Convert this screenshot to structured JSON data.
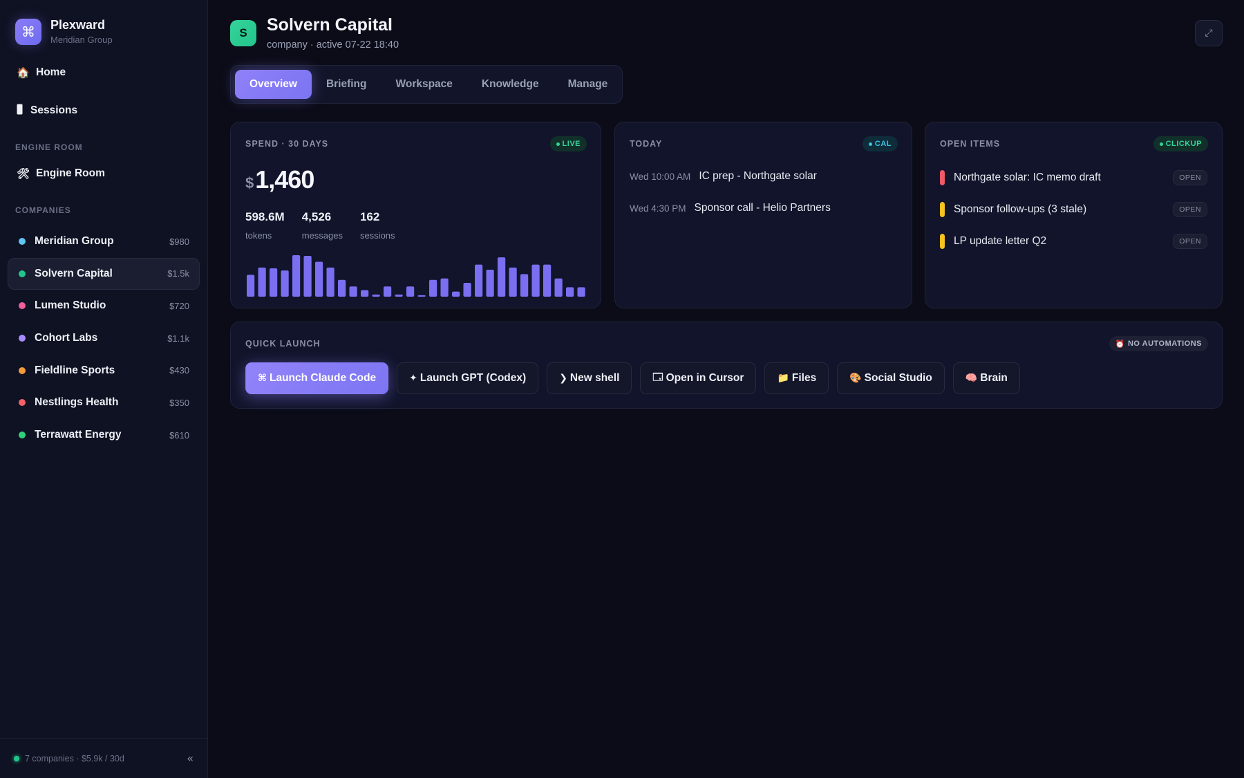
{
  "brand": {
    "name": "Plexward",
    "subtitle": "Meridian Group",
    "logo_glyph": "⌘"
  },
  "nav": {
    "home": {
      "icon": "house-icon",
      "glyph": "🏠",
      "label": "Home"
    },
    "sessions": {
      "icon": "phone-icon",
      "glyph": "📱",
      "label": "Sessions"
    }
  },
  "sections": {
    "engine_room_label": "ENGINE ROOM",
    "companies_label": "COMPANIES"
  },
  "engine_room": {
    "icon": "tools-icon",
    "glyph": "🛠",
    "label": "Engine Room"
  },
  "companies": [
    {
      "name": "Meridian Group",
      "value": "$980",
      "color": "#5fc4f0"
    },
    {
      "name": "Solvern Capital",
      "value": "$1.5k",
      "color": "#22c58b",
      "active": true
    },
    {
      "name": "Lumen Studio",
      "value": "$720",
      "color": "#ee5f9a"
    },
    {
      "name": "Cohort Labs",
      "value": "$1.1k",
      "color": "#a78bfa"
    },
    {
      "name": "Fieldline Sports",
      "value": "$430",
      "color": "#f39a3c"
    },
    {
      "name": "Nestlings Health",
      "value": "$350",
      "color": "#f2606a"
    },
    {
      "name": "Terrawatt Energy",
      "value": "$610",
      "color": "#2fd07a"
    }
  ],
  "footer": {
    "text": "7 companies · $5.9k / 30d",
    "collapse_glyph": "«"
  },
  "header": {
    "avatar_letter": "S",
    "title": "Solvern Capital",
    "subtitle": "company · active 07-22 18:40",
    "expand_glyph": "⤢"
  },
  "tabs": [
    {
      "label": "Overview",
      "active": true
    },
    {
      "label": "Briefing"
    },
    {
      "label": "Workspace"
    },
    {
      "label": "Knowledge"
    },
    {
      "label": "Manage"
    }
  ],
  "spend": {
    "label": "SPEND · 30 DAYS",
    "badge": "LIVE",
    "currency": "$",
    "amount": "1,460",
    "stats": [
      {
        "value": "598.6M",
        "label": "tokens"
      },
      {
        "value": "4,526",
        "label": "messages"
      },
      {
        "value": "162",
        "label": "sessions"
      }
    ],
    "bar_color": "#7a6ff0",
    "daily": [
      30,
      40,
      39,
      36,
      57,
      56,
      48,
      40,
      23,
      14,
      9,
      3,
      14,
      3,
      14,
      2,
      23,
      25,
      7,
      19,
      44,
      37,
      54,
      40,
      31,
      44,
      44,
      25,
      13,
      13
    ]
  },
  "today": {
    "label": "TODAY",
    "badge": "CAL",
    "events": [
      {
        "time": "Wed 10:00 AM",
        "title": "IC prep - Northgate solar"
      },
      {
        "time": "Wed 4:30 PM",
        "title": "Sponsor call - Helio Partners"
      }
    ]
  },
  "open_items": {
    "label": "OPEN ITEMS",
    "badge": "CLICKUP",
    "items": [
      {
        "title": "Northgate solar: IC memo draft",
        "status": "OPEN",
        "color": "#ef5a67"
      },
      {
        "title": "Sponsor follow-ups (3 stale)",
        "status": "OPEN",
        "color": "#f6c31f"
      },
      {
        "title": "LP update letter Q2",
        "status": "OPEN",
        "color": "#f6c31f"
      }
    ]
  },
  "quick_launch": {
    "label": "QUICK LAUNCH",
    "badge": "NO AUTOMATIONS",
    "badge_icon": "alarm-clock-icon",
    "badge_glyph": "⏰",
    "buttons": [
      {
        "glyph": "⌘",
        "label": "Launch Claude Code",
        "icon": "command-icon",
        "primary": true
      },
      {
        "glyph": "✦",
        "label": "Launch GPT (Codex)",
        "icon": "sparkle-icon"
      },
      {
        "glyph": "❯",
        "label": "New shell",
        "icon": "terminal-prompt-icon"
      },
      {
        "glyph": "🗔",
        "label": "Open in Cursor",
        "icon": "window-icon"
      },
      {
        "glyph": "📁",
        "label": "Files",
        "icon": "folder-icon"
      },
      {
        "glyph": "🎨",
        "label": "Social Studio",
        "icon": "palette-icon"
      },
      {
        "glyph": "🧠",
        "label": "Brain",
        "icon": "brain-icon"
      }
    ]
  }
}
